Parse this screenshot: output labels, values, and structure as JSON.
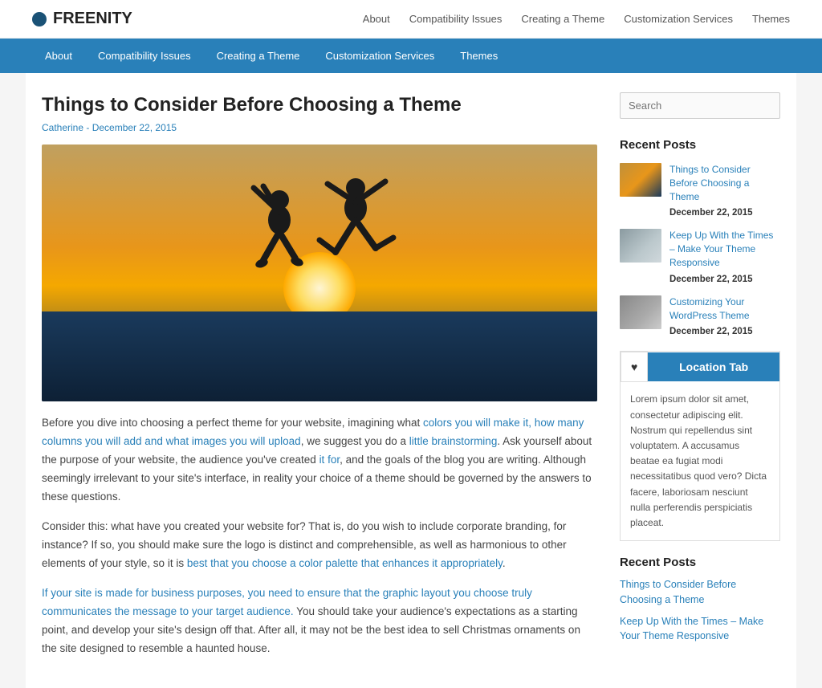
{
  "site": {
    "logo_text": "FREENITY",
    "logo_dot_color": "#1a5276"
  },
  "top_nav": {
    "items": [
      {
        "label": "About",
        "href": "#"
      },
      {
        "label": "Compatibility Issues",
        "href": "#"
      },
      {
        "label": "Creating a Theme",
        "href": "#"
      },
      {
        "label": "Customization Services",
        "href": "#"
      },
      {
        "label": "Themes",
        "href": "#"
      }
    ]
  },
  "blue_nav": {
    "items": [
      {
        "label": "About",
        "href": "#"
      },
      {
        "label": "Compatibility Issues",
        "href": "#"
      },
      {
        "label": "Creating a Theme",
        "href": "#"
      },
      {
        "label": "Customization Services",
        "href": "#"
      },
      {
        "label": "Themes",
        "href": "#"
      }
    ]
  },
  "post": {
    "title": "Things to Consider Before Choosing a Theme",
    "meta": "Catherine - December 22, 2015",
    "body_p1": "Before you dive into choosing a perfect theme for your website, imagining what colors you will make it, how many columns you will add and what images you will upload, we suggest you do a little brainstorming. Ask yourself about the purpose of your website, the audience you've created it for, and the goals of the blog you are writing. Although seemingly irrelevant to your site's interface, in reality your choice of a theme should be governed by the answers to these questions.",
    "body_p2": "Consider this: what have you created your website for? That is, do you wish to include corporate branding, for instance? If so, you should make sure the logo is distinct and comprehensible, as well as harmonious to other elements of your style, so it is best that you choose a color palette that enhances it appropriately.",
    "body_p3": "If your site is made for business purposes, you need to ensure that the graphic layout you choose truly communicates the message to your target audience. You should take your audience's expectations as a starting point, and develop your site's design off that. After all, it may not be the best idea to sell Christmas ornaments on the site designed to resemble a haunted house."
  },
  "sidebar": {
    "search_placeholder": "Search",
    "recent_posts_title": "Recent Posts",
    "recent_posts": [
      {
        "title": "Things to Consider Before Choosing a Theme",
        "date": "December 22, 2015",
        "thumb": "thumb-1"
      },
      {
        "title": "Keep Up With the Times – Make Your Theme Responsive",
        "date": "December 22, 2015",
        "thumb": "thumb-2"
      },
      {
        "title": "Customizing Your WordPress Theme",
        "date": "December 22, 2015",
        "thumb": "thumb-3"
      }
    ],
    "location_heart": "♥",
    "location_tab_label": "Location Tab",
    "location_body": "Lorem ipsum dolor sit amet, consectetur adipiscing elit. Nostrum qui repellendus sint voluptatem. A accusamus beatae ea fugiat modi necessitatibus quod vero? Dicta facere, laboriosam nesciunt nulla perferendis perspiciatis placeat.",
    "recent_posts_title_2": "Recent Posts",
    "recent_links": [
      {
        "label": "Things to Consider Before Choosing a Theme",
        "href": "#"
      },
      {
        "label": "Keep Up With the Times – Make Your Theme Responsive",
        "href": "#"
      }
    ]
  }
}
